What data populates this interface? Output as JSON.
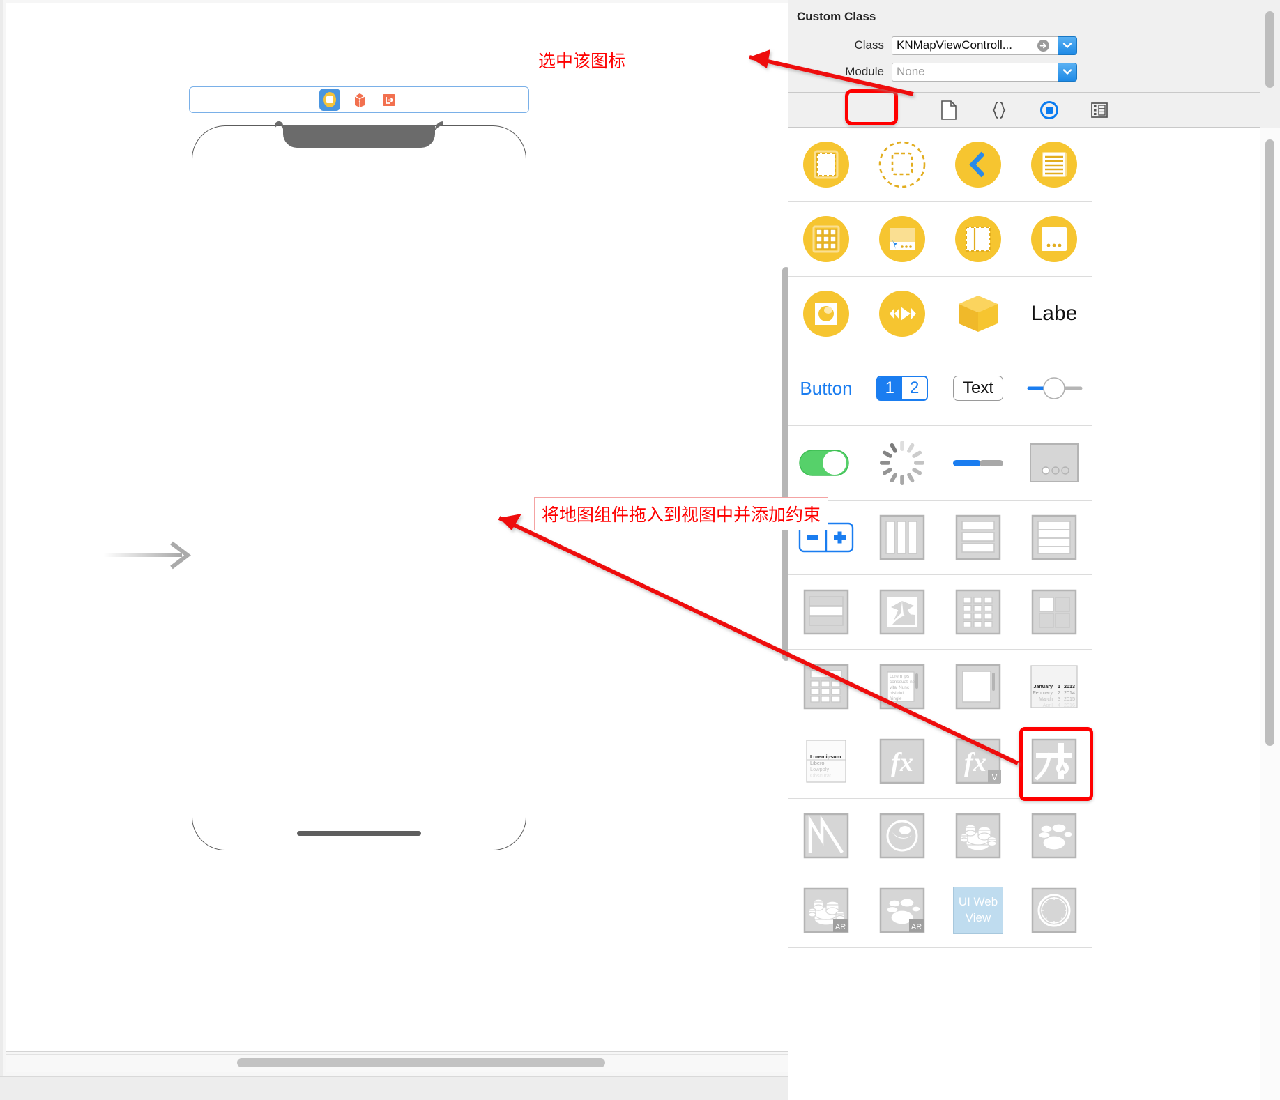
{
  "app": "Xcode Interface Builder",
  "annotations": [
    {
      "id": "select-icon-note",
      "text": "选中该图标"
    },
    {
      "id": "drag-map-note",
      "text": "将地图组件拖入到视图中并添加约束"
    }
  ],
  "canvas": {
    "scene_dock": {
      "items": [
        {
          "name": "view-controller-icon",
          "label": "View Controller",
          "selected": true
        },
        {
          "name": "first-responder-icon",
          "label": "First Responder",
          "selected": false
        },
        {
          "name": "exit-icon",
          "label": "Exit",
          "selected": false
        }
      ]
    },
    "device": {
      "name": "iPhone X",
      "has_notch": true,
      "has_home_indicator": true
    },
    "entry_point_arrow": "storyboard-entry-point"
  },
  "inspector": {
    "title": "Custom Class",
    "rows": [
      {
        "label": "Class",
        "value": "KNMapViewControll...",
        "placeholder": "",
        "has_jump_badge": true
      },
      {
        "label": "Module",
        "value": "",
        "placeholder": "None",
        "has_jump_badge": false
      }
    ]
  },
  "library": {
    "tabs": [
      {
        "name": "file-template-library",
        "glyph": "file",
        "selected": false
      },
      {
        "name": "code-snippet-library",
        "glyph": "braces",
        "selected": false
      },
      {
        "name": "object-library",
        "glyph": "circle-square",
        "selected": true
      },
      {
        "name": "media-library",
        "glyph": "filmstrip",
        "selected": false
      }
    ],
    "selected_tab": "object-library",
    "highlighted_item": "map-kit-view",
    "items": [
      {
        "i": 0,
        "name": "view-controller",
        "kind": "round-dashed-rect"
      },
      {
        "i": 1,
        "name": "storyboard-reference",
        "kind": "dashed-circle-rect"
      },
      {
        "i": 2,
        "name": "navigation-controller",
        "kind": "round-chevron-left"
      },
      {
        "i": 3,
        "name": "table-view-controller",
        "kind": "round-lines-doc"
      },
      {
        "i": 4,
        "name": "collection-view-controller",
        "kind": "round-grid9"
      },
      {
        "i": 5,
        "name": "tab-bar-controller",
        "kind": "round-tabbar"
      },
      {
        "i": 6,
        "name": "split-view-controller",
        "kind": "round-split"
      },
      {
        "i": 7,
        "name": "page-view-controller",
        "kind": "round-dots"
      },
      {
        "i": 8,
        "name": "gl-kit-view-controller",
        "kind": "round-sphere"
      },
      {
        "i": 9,
        "name": "avkit-player-view-controller",
        "kind": "round-transport"
      },
      {
        "i": 10,
        "name": "object",
        "kind": "cube"
      },
      {
        "i": 11,
        "name": "label",
        "kind": "text",
        "text": "Labe"
      },
      {
        "i": 12,
        "name": "button",
        "kind": "text",
        "text": "Button"
      },
      {
        "i": 13,
        "name": "segmented-control",
        "kind": "segmented",
        "seg1": "1",
        "seg2": "2"
      },
      {
        "i": 14,
        "name": "text-field",
        "kind": "textfield",
        "text": "Text"
      },
      {
        "i": 15,
        "name": "slider",
        "kind": "slider"
      },
      {
        "i": 16,
        "name": "switch",
        "kind": "switch"
      },
      {
        "i": 17,
        "name": "activity-indicator-view",
        "kind": "spinner"
      },
      {
        "i": 18,
        "name": "progress-view",
        "kind": "progress"
      },
      {
        "i": 19,
        "name": "page-control",
        "kind": "gray-dots"
      },
      {
        "i": 20,
        "name": "stepper",
        "kind": "stepper"
      },
      {
        "i": 21,
        "name": "horizontal-stack-view",
        "kind": "hstack"
      },
      {
        "i": 22,
        "name": "vertical-stack-view",
        "kind": "vstack"
      },
      {
        "i": 23,
        "name": "table-view",
        "kind": "table"
      },
      {
        "i": 24,
        "name": "table-view-cell",
        "kind": "table-cell"
      },
      {
        "i": 25,
        "name": "image-view",
        "kind": "image"
      },
      {
        "i": 26,
        "name": "collection-view",
        "kind": "grid12"
      },
      {
        "i": 27,
        "name": "collection-view-cell",
        "kind": "grid4"
      },
      {
        "i": 28,
        "name": "collection-reusable-view",
        "kind": "grid-header"
      },
      {
        "i": 29,
        "name": "text-view",
        "kind": "lorem",
        "text": "Lorem ips conseuati nec vital Nunc nisi dui fringle"
      },
      {
        "i": 30,
        "name": "scroll-view",
        "kind": "scrollview"
      },
      {
        "i": 31,
        "name": "date-picker",
        "kind": "datepicker",
        "rows": [
          [
            "January",
            "1",
            "2013"
          ],
          [
            "February",
            "2",
            "2014"
          ],
          [
            "March",
            "3",
            "2015"
          ],
          [
            "April",
            "4",
            "2016"
          ]
        ]
      },
      {
        "i": 32,
        "name": "picker-view",
        "kind": "picker",
        "lines": [
          "Loremipsum",
          "Libero",
          "Lowpoly",
          "Obscurat"
        ]
      },
      {
        "i": 33,
        "name": "visual-effect-view-blur",
        "kind": "fx"
      },
      {
        "i": 34,
        "name": "visual-effect-view-vibrancy",
        "kind": "fx-v",
        "badge": "V"
      },
      {
        "i": 35,
        "name": "map-kit-view",
        "kind": "map"
      },
      {
        "i": 36,
        "name": "mtk-view",
        "kind": "metal"
      },
      {
        "i": 37,
        "name": "gl-kit-view",
        "kind": "sphere-gray"
      },
      {
        "i": 38,
        "name": "scene-kit-view",
        "kind": "scenekit"
      },
      {
        "i": 39,
        "name": "sprite-kit-view",
        "kind": "spritekit"
      },
      {
        "i": 40,
        "name": "arscn-view",
        "kind": "scenekit",
        "badge": "AR"
      },
      {
        "i": 41,
        "name": "arsk-view",
        "kind": "spritekit",
        "badge": "AR"
      },
      {
        "i": 42,
        "name": "ui-web-view",
        "kind": "webview",
        "text": "UI Web View"
      },
      {
        "i": 43,
        "name": "wk-web-view",
        "kind": "compass"
      }
    ]
  }
}
